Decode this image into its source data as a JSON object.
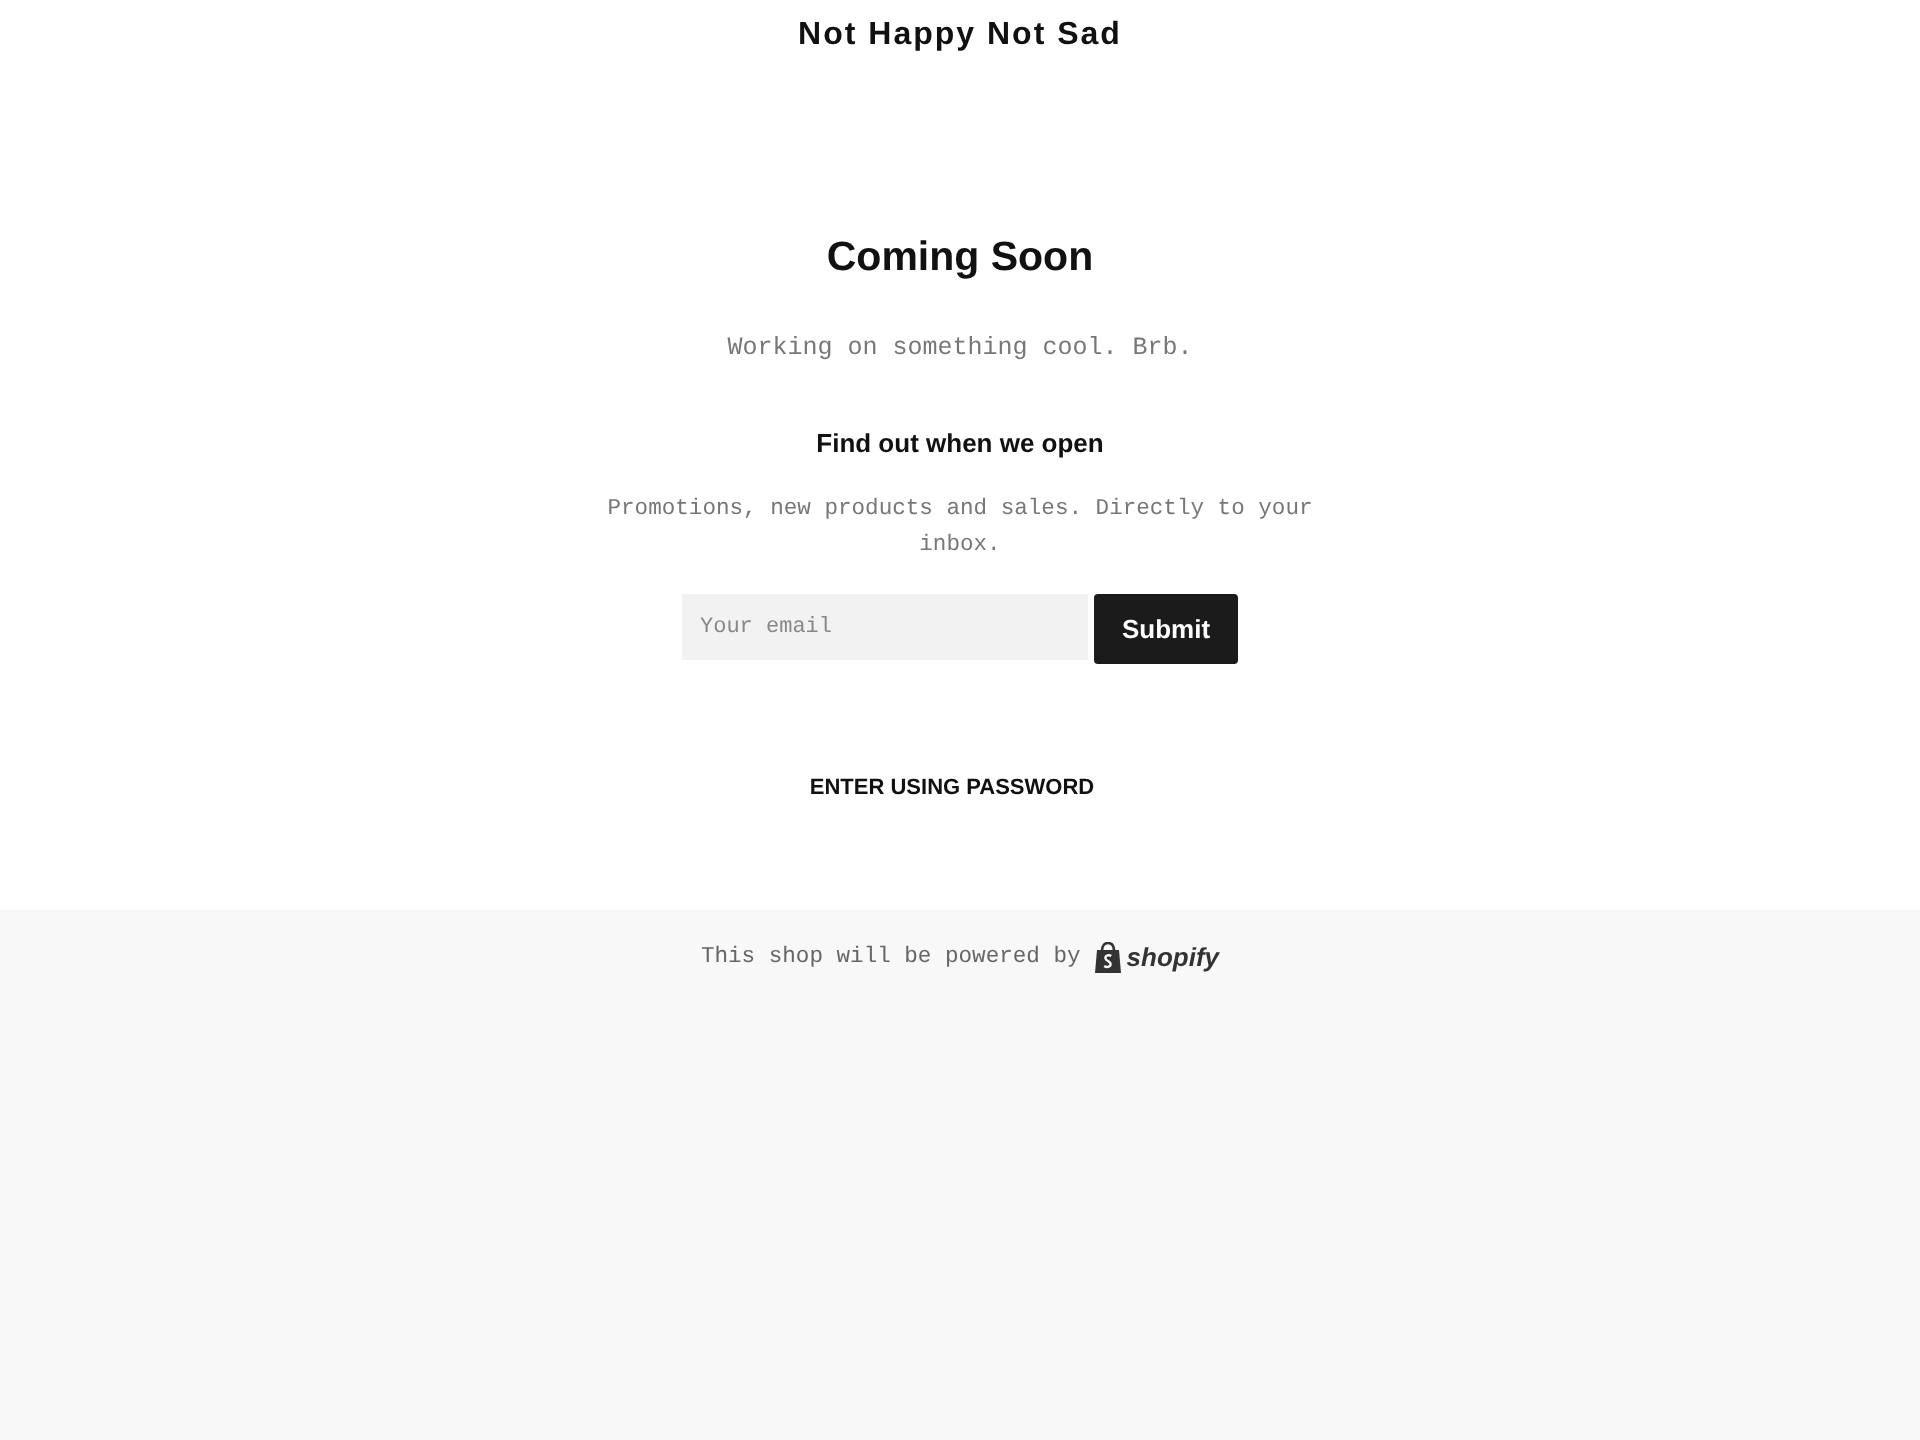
{
  "header": {
    "title": "Not Happy Not Sad"
  },
  "main": {
    "heading": "Coming Soon",
    "message": "Working on something cool. Brb."
  },
  "signup": {
    "heading": "Find out when we open",
    "text": "Promotions, new products and sales. Directly to your inbox.",
    "email": {
      "placeholder": "Your email"
    },
    "button": "Submit"
  },
  "password_link": "ENTER USING PASSWORD",
  "footer": {
    "text": "This shop will be powered by",
    "logo_text": "shopify"
  }
}
